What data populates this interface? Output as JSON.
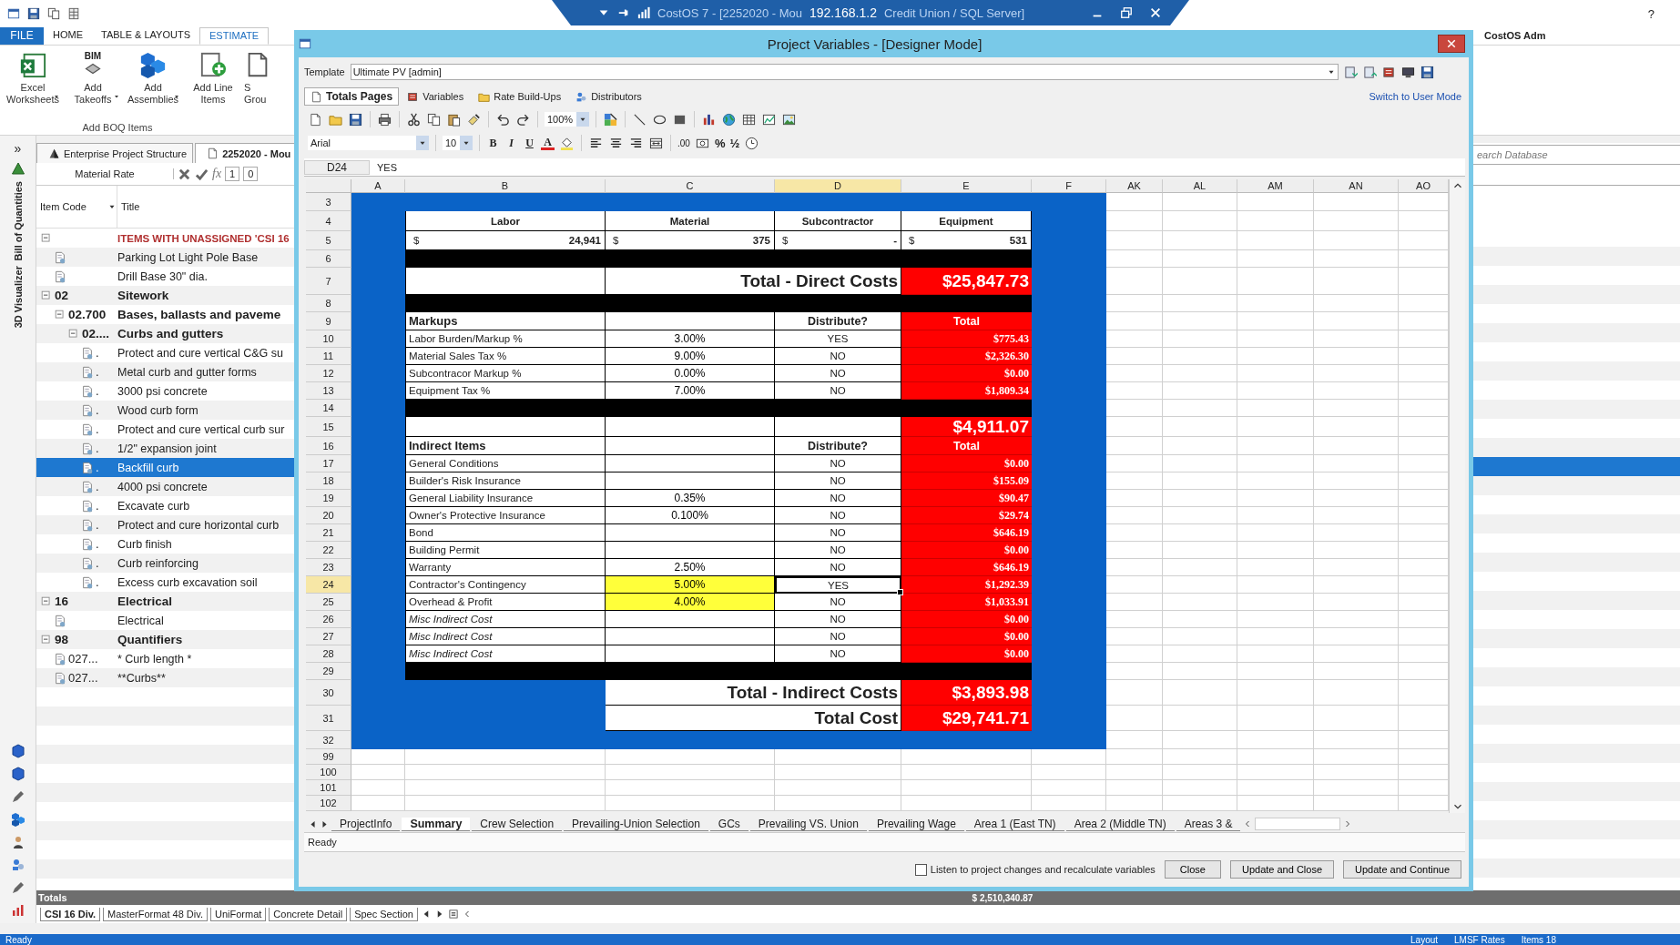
{
  "title_bar": {
    "app_title": "CostOS 7 - [2252020 - Mou",
    "server": "192.168.1.2",
    "database": "Credit Union  / SQL Server]",
    "help": "?"
  },
  "ribbon": {
    "tabs": [
      {
        "label": "FILE",
        "kind": "file",
        "selected": false
      },
      {
        "label": "HOME",
        "kind": "tab",
        "selected": false
      },
      {
        "label": "TABLE & LAYOUTS",
        "kind": "tab",
        "selected": false
      },
      {
        "label": "ESTIMATE",
        "kind": "tab",
        "selected": true
      }
    ],
    "user": "CostOS Adm",
    "buttons": [
      {
        "lines": [
          "Excel",
          "Worksheets"
        ],
        "dropdown": true
      },
      {
        "lines": [
          "Add",
          "Takeoffs"
        ],
        "badge": "BIM",
        "dropdown": true
      },
      {
        "lines": [
          "Add",
          "Assemblies"
        ],
        "dropdown": true
      },
      {
        "lines": [
          "Add Line",
          "Items"
        ],
        "dropdown": false
      },
      {
        "lines": [
          "S",
          "Grou"
        ],
        "dropdown": false
      }
    ],
    "group_label": "Add BOQ Items"
  },
  "side_strip": {
    "expand": "»",
    "labels": [
      "Bill of Quantities",
      "3D Visualizer"
    ]
  },
  "doc_tabs": [
    {
      "label": "Enterprise Project Structure",
      "selected": false
    },
    {
      "label": "2252020 - Mou",
      "selected": true
    }
  ],
  "formula": {
    "field": "Material Rate",
    "fx": "fx",
    "boxes": [
      "1",
      "0"
    ]
  },
  "tree": {
    "columns": [
      "Item Code",
      "Title"
    ],
    "rows": [
      {
        "kind": "unassigned",
        "code": "",
        "title": "ITEMS WITH UNASSIGNED 'CSI 16",
        "expanded": true,
        "selected": false,
        "children": [
          {
            "kind": "item",
            "title": "Parking Lot Light Pole Base",
            "selected": false
          },
          {
            "kind": "item",
            "title": "Drill Base 30\" dia.",
            "selected": false
          }
        ]
      },
      {
        "kind": "group",
        "code": "02",
        "title": "Sitework",
        "expanded": true,
        "selected": false,
        "children": [
          {
            "kind": "group",
            "code": "02.700",
            "title": "Bases, ballasts and paveme",
            "expanded": true,
            "selected": false,
            "children": [
              {
                "kind": "group",
                "code": "02....",
                "title": "Curbs and gutters",
                "expanded": true,
                "selected": false,
                "children": [
                  {
                    "kind": "item",
                    "code": ".",
                    "title": "Protect and cure vertical C&G su",
                    "selected": false
                  },
                  {
                    "kind": "item",
                    "code": ".",
                    "title": "Metal curb and gutter forms",
                    "selected": false
                  },
                  {
                    "kind": "item",
                    "code": ".",
                    "title": "3000 psi concrete",
                    "selected": false
                  },
                  {
                    "kind": "item",
                    "code": ".",
                    "title": "Wood curb form",
                    "selected": false
                  },
                  {
                    "kind": "item",
                    "code": ".",
                    "title": "Protect and cure vertical curb sur",
                    "selected": false
                  },
                  {
                    "kind": "item",
                    "code": ".",
                    "title": "1/2\" expansion joint",
                    "selected": false
                  },
                  {
                    "kind": "item",
                    "code": ".",
                    "title": "Backfill curb",
                    "selected": true
                  },
                  {
                    "kind": "item",
                    "code": ".",
                    "title": "4000 psi concrete",
                    "selected": false
                  },
                  {
                    "kind": "item",
                    "code": ".",
                    "title": "Excavate curb",
                    "selected": false
                  },
                  {
                    "kind": "item",
                    "code": ".",
                    "title": "Protect and cure horizontal curb",
                    "selected": false
                  },
                  {
                    "kind": "item",
                    "code": ".",
                    "title": "Curb finish",
                    "selected": false
                  },
                  {
                    "kind": "item",
                    "code": ".",
                    "title": "Curb reinforcing",
                    "selected": false
                  },
                  {
                    "kind": "item",
                    "code": ".",
                    "title": "Excess curb excavation soil",
                    "selected": false
                  }
                ]
              }
            ]
          }
        ]
      },
      {
        "kind": "group",
        "code": "16",
        "title": "Electrical",
        "expanded": true,
        "selected": false,
        "children": [
          {
            "kind": "item",
            "title": "Electrical",
            "selected": false
          }
        ]
      },
      {
        "kind": "group",
        "code": "98",
        "title": "Quantifiers",
        "expanded": true,
        "selected": false,
        "children": [
          {
            "kind": "item",
            "code": "027...",
            "title": "* Curb length *",
            "selected": false
          },
          {
            "kind": "item",
            "code": "027...",
            "title": "**Curbs**",
            "selected": false
          }
        ]
      }
    ]
  },
  "right_panel": {
    "search_placeholder": "earch Database"
  },
  "totals": {
    "label": "Totals",
    "value": "$ 2,510,340.87"
  },
  "sheet_tabs": [
    {
      "label": "CSI 16 Div.",
      "selected": true
    },
    {
      "label": "MasterFormat 48 Div.",
      "selected": false
    },
    {
      "label": "UniFormat",
      "selected": false
    },
    {
      "label": "Concrete Detail",
      "selected": false
    },
    {
      "label": "Spec Section",
      "selected": false
    }
  ],
  "status_bar": {
    "left": "Ready",
    "items": [
      "Layout",
      "LMSF Rates",
      "Items  18"
    ]
  },
  "dialog": {
    "title": "Project Variables - [Designer Mode]",
    "template": {
      "label": "Template",
      "value": "Ultimate PV [admin]"
    },
    "tabs": [
      {
        "label": "Totals Pages",
        "selected": true
      },
      {
        "label": "Variables",
        "selected": false
      },
      {
        "label": "Rate Build-Ups",
        "selected": false
      },
      {
        "label": "Distributors",
        "selected": false
      }
    ],
    "mode_link": "Switch to User Mode",
    "zoom": "100%",
    "font": "Arial",
    "font_size": "10",
    "format_buttons": [
      "B",
      "I",
      "U",
      "A"
    ],
    "number_buttons": [
      ".00",
      "%",
      "½"
    ],
    "cell_ref": "D24",
    "cell_value": "YES",
    "columns": [
      {
        "label": "A",
        "selected": false
      },
      {
        "label": "B",
        "selected": false
      },
      {
        "label": "C",
        "selected": false
      },
      {
        "label": "D",
        "selected": true
      },
      {
        "label": "E",
        "selected": false
      },
      {
        "label": "F",
        "selected": false
      },
      {
        "label": "AK",
        "selected": false
      },
      {
        "label": "AL",
        "selected": false
      },
      {
        "label": "AM",
        "selected": false
      },
      {
        "label": "AN",
        "selected": false
      },
      {
        "label": "AO",
        "selected": false
      }
    ],
    "rows": [
      {
        "num": "3",
        "kind": "band"
      },
      {
        "num": "4",
        "kind": "heads",
        "cells": [
          "Labor",
          "Material",
          "Subcontractor",
          "Equipment"
        ]
      },
      {
        "num": "5",
        "kind": "amounts",
        "cells": [
          {
            "currency": "$",
            "amount": "24,941"
          },
          {
            "currency": "$",
            "amount": "375"
          },
          {
            "currency": "$",
            "amount": "-"
          },
          {
            "currency": "$",
            "amount": "531"
          }
        ]
      },
      {
        "num": "6",
        "kind": "bar"
      },
      {
        "num": "7",
        "kind": "total",
        "label": "Total - Direct Costs",
        "value": "$25,847.73"
      },
      {
        "num": "8",
        "kind": "bar"
      },
      {
        "num": "9",
        "kind": "section",
        "label": "Markups",
        "distribute": "Distribute?",
        "total": "Total"
      },
      {
        "num": "10",
        "kind": "item",
        "label": "Labor Burden/Markup %",
        "rate": "3.00%",
        "distribute": "YES",
        "amount": "$775.43",
        "italic": false,
        "highlight": false,
        "selected": false
      },
      {
        "num": "11",
        "kind": "item",
        "label": "Material Sales Tax %",
        "rate": "9.00%",
        "distribute": "NO",
        "amount": "$2,326.30",
        "italic": false,
        "highlight": false,
        "selected": false
      },
      {
        "num": "12",
        "kind": "item",
        "label": "Subcontracor Markup %",
        "rate": "0.00%",
        "distribute": "NO",
        "amount": "$0.00",
        "italic": false,
        "highlight": false,
        "selected": false
      },
      {
        "num": "13",
        "kind": "item",
        "label": "Equipment Tax %",
        "rate": "7.00%",
        "distribute": "NO",
        "amount": "$1,809.34",
        "italic": false,
        "highlight": false,
        "selected": false
      },
      {
        "num": "14",
        "kind": "bar"
      },
      {
        "num": "15",
        "kind": "subtotal",
        "value": "$4,911.07"
      },
      {
        "num": "16",
        "kind": "section",
        "label": "Indirect Items",
        "distribute": "Distribute?",
        "total": "Total"
      },
      {
        "num": "17",
        "kind": "item",
        "label": "General Conditions",
        "rate": "",
        "distribute": "NO",
        "amount": "$0.00",
        "italic": false,
        "highlight": false,
        "selected": false
      },
      {
        "num": "18",
        "kind": "item",
        "label": "Builder's Risk Insurance",
        "rate": "",
        "distribute": "NO",
        "amount": "$155.09",
        "italic": false,
        "highlight": false,
        "selected": false
      },
      {
        "num": "19",
        "kind": "item",
        "label": "General Liability Insurance",
        "rate": "0.35%",
        "distribute": "NO",
        "amount": "$90.47",
        "italic": false,
        "highlight": false,
        "selected": false
      },
      {
        "num": "20",
        "kind": "item",
        "label": "Owner's Protective Insurance",
        "rate": "0.100%",
        "distribute": "NO",
        "amount": "$29.74",
        "italic": false,
        "highlight": false,
        "selected": false
      },
      {
        "num": "21",
        "kind": "item",
        "label": "Bond",
        "rate": "",
        "distribute": "NO",
        "amount": "$646.19",
        "italic": false,
        "highlight": false,
        "selected": false
      },
      {
        "num": "22",
        "kind": "item",
        "label": "Building Permit",
        "rate": "",
        "distribute": "NO",
        "amount": "$0.00",
        "italic": false,
        "highlight": false,
        "selected": false
      },
      {
        "num": "23",
        "kind": "item",
        "label": "Warranty",
        "rate": "2.50%",
        "distribute": "NO",
        "amount": "$646.19",
        "italic": false,
        "highlight": false,
        "selected": false
      },
      {
        "num": "24",
        "kind": "item",
        "label": "Contractor's Contingency",
        "rate": "5.00%",
        "distribute": "YES",
        "amount": "$1,292.39",
        "italic": false,
        "highlight": true,
        "selected": true
      },
      {
        "num": "25",
        "kind": "item",
        "label": "Overhead & Profit",
        "rate": "4.00%",
        "distribute": "NO",
        "amount": "$1,033.91",
        "italic": false,
        "highlight": true,
        "selected": false
      },
      {
        "num": "26",
        "kind": "item",
        "label": "Misc Indirect Cost",
        "rate": "",
        "distribute": "NO",
        "amount": "$0.00",
        "italic": true,
        "highlight": false,
        "selected": false
      },
      {
        "num": "27",
        "kind": "item",
        "label": "Misc Indirect Cost",
        "rate": "",
        "distribute": "NO",
        "amount": "$0.00",
        "italic": true,
        "highlight": false,
        "selected": false
      },
      {
        "num": "28",
        "kind": "item",
        "label": "Misc Indirect Cost",
        "rate": "",
        "distribute": "NO",
        "amount": "$0.00",
        "italic": true,
        "highlight": false,
        "selected": false
      },
      {
        "num": "29",
        "kind": "bar"
      },
      {
        "num": "30",
        "kind": "summary",
        "label": "Total - Indirect Costs",
        "value": "$3,893.98"
      },
      {
        "num": "31",
        "kind": "summary",
        "label": "Total Cost",
        "value": "$29,741.71"
      },
      {
        "num": "32",
        "kind": "band"
      },
      {
        "num": "99",
        "kind": "empty"
      },
      {
        "num": "100",
        "kind": "empty"
      },
      {
        "num": "101",
        "kind": "empty"
      },
      {
        "num": "102",
        "kind": "empty"
      }
    ],
    "sheet_tabs": [
      {
        "label": "ProjectInfo",
        "selected": false
      },
      {
        "label": "Summary",
        "selected": true
      },
      {
        "label": "Crew Selection",
        "selected": false
      },
      {
        "label": "Prevailing-Union Selection",
        "selected": false
      },
      {
        "label": "GCs",
        "selected": false
      },
      {
        "label": "Prevailing VS. Union",
        "selected": false
      },
      {
        "label": "Prevailing Wage",
        "selected": false
      },
      {
        "label": "Area 1 (East TN)",
        "selected": false
      },
      {
        "label": "Area 2 (Middle TN)",
        "selected": false
      },
      {
        "label": "Areas 3 &",
        "selected": false
      }
    ],
    "status": "Ready",
    "listen": {
      "label": "Listen to project changes and recalculate variables",
      "checked": false
    },
    "buttons": [
      "Close",
      "Update and Close",
      "Update and Continue"
    ]
  }
}
